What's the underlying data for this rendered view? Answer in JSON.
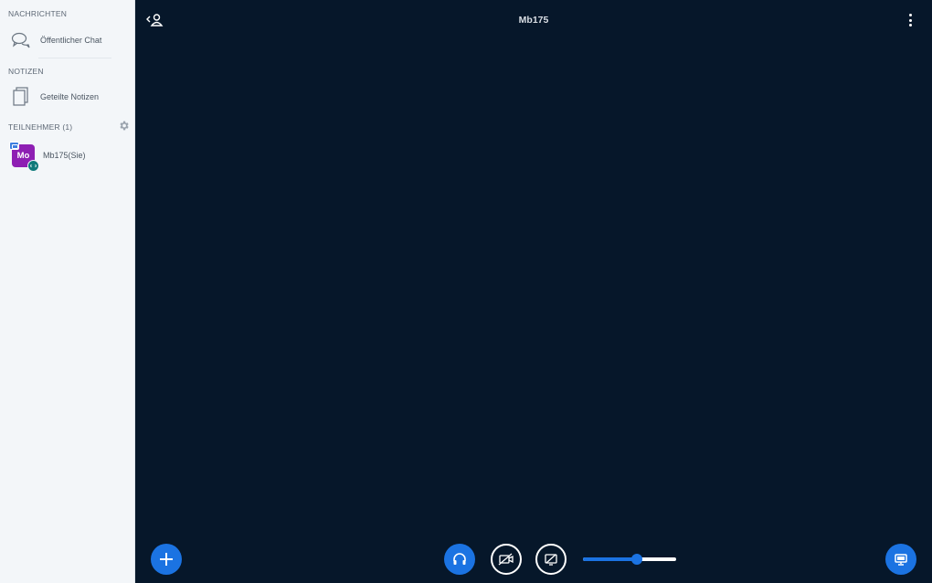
{
  "sidebar": {
    "messages_title": "NACHRICHTEN",
    "public_chat": "Öffentlicher Chat",
    "notes_title": "NOTIZEN",
    "shared_notes": "Geteilte Notizen",
    "participants_title": "TEILNEHMER (1)",
    "users": [
      {
        "initials": "Mo",
        "name": "Mb175(Sie)"
      }
    ]
  },
  "header": {
    "title": "Mb175"
  },
  "controls": {
    "volume_level": 0.58
  },
  "colors": {
    "accent": "#1b73e2",
    "avatar": "#8e1fb3",
    "background": "#06172a",
    "sidebar": "#f3f6f9"
  },
  "icons": {
    "chat": "chat-icon",
    "notes": "notes-icon",
    "gear": "gear-icon",
    "user_toggle": "user-list-toggle-icon",
    "more": "more-vertical-icon",
    "plus": "plus-icon",
    "headphones": "headphones-icon",
    "camera_off": "camera-off-icon",
    "screenshare_off": "screenshare-off-icon",
    "presentation": "presentation-icon"
  }
}
